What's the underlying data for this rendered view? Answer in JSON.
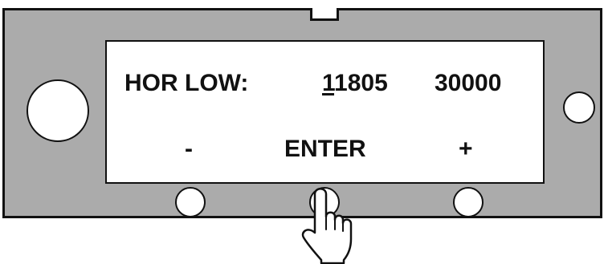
{
  "display": {
    "param_label": "HOR LOW:",
    "current_value_cursor_digit": "1",
    "current_value_rest": "1805",
    "max_value": "30000"
  },
  "soft_keys": {
    "minus_label": "-",
    "enter_label": "ENTER",
    "plus_label": "+"
  },
  "colors": {
    "panel": "#ababab",
    "screen": "#ffffff",
    "outline": "#111111"
  },
  "icons": {
    "pointer": "hand-pointer-icon"
  }
}
